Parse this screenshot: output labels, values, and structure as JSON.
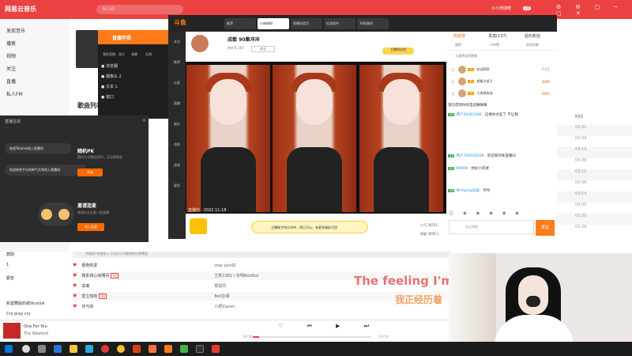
{
  "netease": {
    "app_name": "网易云音乐",
    "search_placeholder": "好心动",
    "user": "小小肉球呀",
    "vip": "VIP",
    "win_buttons": "⚙ ✉ ▢ ─ □ ✕",
    "nav": [
      "发现音乐",
      "播客",
      "视频",
      "关注",
      "直播",
      "私人FM"
    ],
    "section_title": "歌曲列表",
    "lower_nav": [
      "鼓励",
      "1",
      "颤音",
      "新建舞蹈的歌Studiok",
      "Cry pray cry"
    ],
    "time_header": "时间",
    "times": [
      "03:22",
      "03:04",
      "04:19",
      "03:38",
      "03:12",
      "03:06",
      "03:14",
      "04:05",
      "03:25",
      "03:28"
    ],
    "table_header": "共播放1首歌曲 ▸ 点击显示问题更新后都覆盖",
    "rows": [
      {
        "title": "很奇的爱",
        "tag": "",
        "artist": "stay jack的"
      },
      {
        "title": "我本将心向明月",
        "tag": "SQ",
        "artist": "王新1982 / 张明BoxBox"
      },
      {
        "title": "逃离",
        "tag": "",
        "artist": "那碧风"
      },
      {
        "title": "爱立刻有",
        "tag": "SQ",
        "artist": "Bell彭蕾"
      },
      {
        "title": "花与剑",
        "tag": "",
        "artist": "小野Zanon"
      }
    ],
    "player": {
      "title": "One For You",
      "artist": "The Weeknd",
      "elapsed": "00:00",
      "total": "04:19",
      "controls": "♡ ⏮ ▶ ⏭"
    }
  },
  "lyrics": {
    "line1": "The feeling I'm g",
    "line2": "我正经历着"
  },
  "companion": {
    "title": "直播伴侣",
    "tabs": [
      "我的直播",
      "观众",
      "弹幕",
      "礼物"
    ],
    "layers": [
      "●  浏览器",
      "●  摄像头 2",
      "●  文本 1",
      "●  窗口"
    ]
  },
  "dialog": {
    "title": "直播互动",
    "close": "✕",
    "msg1": "欢迎Totolisk进入直播间",
    "msg2": "欢迎哈哈手头的帅气大哥进入直播间",
    "pk_title": "随机PK",
    "pk_desc": "随机与主播连线PK，互动更精彩",
    "pk_btn": "开始",
    "link_title": "邀请连麦",
    "link_desc": "邀请好友连麦一起直播",
    "link_btn": "进入连麦"
  },
  "douyu": {
    "logo": "斗鱼",
    "tabs": [
      "推荐",
      "小肉球呀",
      "直播间首页",
      "在游戏中",
      "36秒最初"
    ],
    "left_nav": [
      "关注",
      "推荐",
      "分类",
      "直播",
      "娱乐",
      "消息",
      "游戏",
      "更多"
    ],
    "streamer": "成都 90集冲冲",
    "sub": "房间号 307",
    "follow": "关注",
    "badge": "主播粉丝团",
    "watermark": "直播中 · 2022.11.18",
    "banner": "主播刚才快乐冲冲，明日可以，有更多精彩可用",
    "stats1": "人气 28761",
    "stats2": "热度 3059.1"
  },
  "chat": {
    "tabs": [
      "高能榜",
      "贵宾(137)",
      "钻石粉丝"
    ],
    "subtabs": [
      "周榜",
      "小时榜",
      "本场贡献"
    ],
    "note": "土豪榜实时更新",
    "ranks": [
      {
        "n": "1",
        "lv": "24",
        "name": "欢迎莉莉",
        "pts": "7.1万"
      },
      {
        "n": "2",
        "lv": "18",
        "name": "超级大叔子",
        "pts": "5000"
      },
      {
        "n": "3",
        "lv": "12",
        "name": "小肉球加油",
        "pts": "2091"
      }
    ],
    "messages": [
      {
        "user": "",
        "lv": "",
        "text": "现在得到你的电话嘛嘛嘛"
      },
      {
        "user": "用户54283396",
        "lv": "15",
        "text": "：这要你太狂了 不让我"
      },
      {
        "user": "用户782626458",
        "lv": "13",
        "text": "：欢迎来到本直播间"
      },
      {
        "user": "99999",
        "lv": "22",
        "text": "：你好小肉球"
      },
      {
        "user": "MrHuang先森",
        "lv": "19",
        "text": "：夸夸"
      }
    ],
    "icons": "☺ ◆ ◆ ◆ ◆ ◆",
    "input_placeholder": "发送弹幕",
    "send": "发送"
  }
}
